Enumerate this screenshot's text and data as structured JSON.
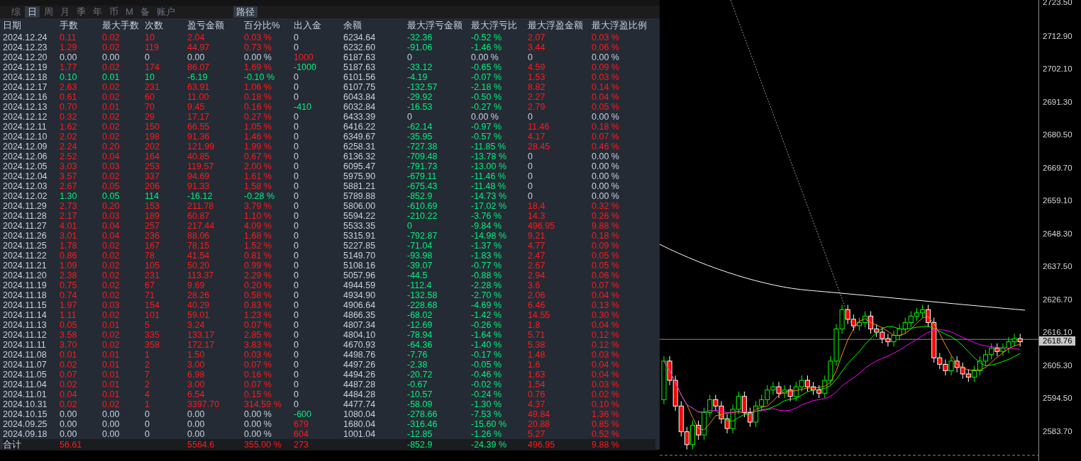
{
  "tabs": [
    {
      "label": "综",
      "selected": false
    },
    {
      "label": "日",
      "selected": true
    },
    {
      "label": "周",
      "selected": false
    },
    {
      "label": "月",
      "selected": false
    },
    {
      "label": "季",
      "selected": false
    },
    {
      "label": "年",
      "selected": false
    },
    {
      "label": "币",
      "selected": false
    },
    {
      "label": "M",
      "selected": false
    },
    {
      "label": "备",
      "selected": false
    },
    {
      "label": "账户",
      "selected": false
    }
  ],
  "path_button": "路径",
  "columns": [
    "日期",
    "手数",
    "最大手数",
    "次数",
    "盈亏金额",
    "百分比%",
    "出入金",
    "余额",
    "最大浮亏金额",
    "最大浮亏比",
    "最大浮盈金额",
    "最大浮盈比例"
  ],
  "rows": [
    {
      "date": "2024.12.24",
      "color": "#ff1a1a",
      "values": [
        "0.11",
        "0.02",
        "10",
        "2.04",
        "0.03 %"
      ],
      "flow": {
        "text": "0",
        "color": "#c8d0dc"
      },
      "balance": "6234.64",
      "loss": {
        "text": "-32.36",
        "pct": "-0.52 %",
        "color": "#00f07a"
      },
      "gain": {
        "text": "2.07",
        "pct": "0.03 %",
        "color": "#ff1a1a"
      }
    },
    {
      "date": "2024.12.23",
      "color": "#ff1a1a",
      "values": [
        "1.29",
        "0.02",
        "119",
        "44.97",
        "0.73 %"
      ],
      "flow": {
        "text": "0",
        "color": "#c8d0dc"
      },
      "balance": "6232.60",
      "loss": {
        "text": "-91.06",
        "pct": "-1.46 %",
        "color": "#00f07a"
      },
      "gain": {
        "text": "3.44",
        "pct": "0.06 %",
        "color": "#ff1a1a"
      }
    },
    {
      "date": "2024.12.20",
      "color": "#c8d0dc",
      "values": [
        "0.00",
        "0.00",
        "0",
        "0.00",
        "0.00 %"
      ],
      "flow": {
        "text": "1000",
        "color": "#ff1a1a"
      },
      "balance": "6187.63",
      "loss": {
        "text": "0",
        "pct": "0.00 %",
        "color": "#c8d0dc"
      },
      "gain": {
        "text": "0",
        "pct": "0.00 %",
        "color": "#c8d0dc"
      }
    },
    {
      "date": "2024.12.19",
      "color": "#ff1a1a",
      "values": [
        "1.77",
        "0.02",
        "174",
        "86.07",
        "1.69 %"
      ],
      "flow": {
        "text": "-1000",
        "color": "#00f07a"
      },
      "balance": "5187.63",
      "loss": {
        "text": "-33.12",
        "pct": "-0.65 %",
        "color": "#00f07a"
      },
      "gain": {
        "text": "4.59",
        "pct": "0.09 %",
        "color": "#ff1a1a"
      }
    },
    {
      "date": "2024.12.18",
      "color": "#00f07a",
      "values": [
        "0.10",
        "0.01",
        "10",
        "-6.19",
        "-0.10 %"
      ],
      "flow": {
        "text": "0",
        "color": "#c8d0dc"
      },
      "balance": "6101.56",
      "loss": {
        "text": "-4.19",
        "pct": "-0.07 %",
        "color": "#00f07a"
      },
      "gain": {
        "text": "1.53",
        "pct": "0.03 %",
        "color": "#ff1a1a"
      }
    },
    {
      "date": "2024.12.17",
      "color": "#ff1a1a",
      "values": [
        "2.63",
        "0.02",
        "231",
        "63.91",
        "1.06 %"
      ],
      "flow": {
        "text": "0",
        "color": "#c8d0dc"
      },
      "balance": "6107.75",
      "loss": {
        "text": "-132.57",
        "pct": "-2.18 %",
        "color": "#00f07a"
      },
      "gain": {
        "text": "8.82",
        "pct": "0.14 %",
        "color": "#ff1a1a"
      }
    },
    {
      "date": "2024.12.16",
      "color": "#ff1a1a",
      "values": [
        "0.61",
        "0.02",
        "60",
        "11.00",
        "0.18 %"
      ],
      "flow": {
        "text": "0",
        "color": "#c8d0dc"
      },
      "balance": "6043.84",
      "loss": {
        "text": "-29.92",
        "pct": "-0.50 %",
        "color": "#00f07a"
      },
      "gain": {
        "text": "2.27",
        "pct": "0.04 %",
        "color": "#ff1a1a"
      }
    },
    {
      "date": "2024.12.13",
      "color": "#ff1a1a",
      "values": [
        "0.70",
        "0.01",
        "70",
        "9.45",
        "0.16 %"
      ],
      "flow": {
        "text": "-410",
        "color": "#00f07a"
      },
      "balance": "6032.84",
      "loss": {
        "text": "-16.53",
        "pct": "-0.27 %",
        "color": "#00f07a"
      },
      "gain": {
        "text": "2.79",
        "pct": "0.05 %",
        "color": "#ff1a1a"
      }
    },
    {
      "date": "2024.12.12",
      "color": "#ff1a1a",
      "values": [
        "0.32",
        "0.02",
        "29",
        "17.17",
        "0.27 %"
      ],
      "flow": {
        "text": "0",
        "color": "#c8d0dc"
      },
      "balance": "6433.39",
      "loss": {
        "text": "0",
        "pct": "0.00 %",
        "color": "#c8d0dc"
      },
      "gain": {
        "text": "0",
        "pct": "0.00 %",
        "color": "#c8d0dc"
      }
    },
    {
      "date": "2024.12.11",
      "color": "#ff1a1a",
      "values": [
        "1.62",
        "0.02",
        "150",
        "66.55",
        "1.05 %"
      ],
      "flow": {
        "text": "0",
        "color": "#c8d0dc"
      },
      "balance": "6416.22",
      "loss": {
        "text": "-62.14",
        "pct": "-0.97 %",
        "color": "#00f07a"
      },
      "gain": {
        "text": "11.46",
        "pct": "0.18 %",
        "color": "#ff1a1a"
      }
    },
    {
      "date": "2024.12.10",
      "color": "#ff1a1a",
      "values": [
        "2.02",
        "0.02",
        "198",
        "91.36",
        "1.46 %"
      ],
      "flow": {
        "text": "0",
        "color": "#c8d0dc"
      },
      "balance": "6349.67",
      "loss": {
        "text": "-35.95",
        "pct": "-0.57 %",
        "color": "#00f07a"
      },
      "gain": {
        "text": "4.17",
        "pct": "0.07 %",
        "color": "#ff1a1a"
      }
    },
    {
      "date": "2024.12.09",
      "color": "#ff1a1a",
      "values": [
        "2.24",
        "0.20",
        "202",
        "121.99",
        "1.99 %"
      ],
      "flow": {
        "text": "0",
        "color": "#c8d0dc"
      },
      "balance": "6258.31",
      "loss": {
        "text": "-727.38",
        "pct": "-11.85 %",
        "color": "#00f07a"
      },
      "gain": {
        "text": "28.45",
        "pct": "0.46 %",
        "color": "#ff1a1a"
      }
    },
    {
      "date": "2024.12.06",
      "color": "#ff1a1a",
      "values": [
        "2.52",
        "0.04",
        "164",
        "40.85",
        "0.67 %"
      ],
      "flow": {
        "text": "0",
        "color": "#c8d0dc"
      },
      "balance": "6136.32",
      "loss": {
        "text": "-709.48",
        "pct": "-13.78 %",
        "color": "#00f07a"
      },
      "gain": {
        "text": "0",
        "pct": "0.00 %",
        "color": "#c8d0dc"
      }
    },
    {
      "date": "2024.12.05",
      "color": "#ff1a1a",
      "values": [
        "3.03",
        "0.03",
        "253",
        "119.57",
        "2.00 %"
      ],
      "flow": {
        "text": "0",
        "color": "#c8d0dc"
      },
      "balance": "6095.47",
      "loss": {
        "text": "-791.73",
        "pct": "-13.00 %",
        "color": "#00f07a"
      },
      "gain": {
        "text": "0",
        "pct": "0.00 %",
        "color": "#c8d0dc"
      }
    },
    {
      "date": "2024.12.04",
      "color": "#ff1a1a",
      "values": [
        "3.57",
        "0.02",
        "337",
        "94.69",
        "1.61 %"
      ],
      "flow": {
        "text": "0",
        "color": "#c8d0dc"
      },
      "balance": "5975.90",
      "loss": {
        "text": "-679.11",
        "pct": "-11.46 %",
        "color": "#00f07a"
      },
      "gain": {
        "text": "0",
        "pct": "0.00 %",
        "color": "#c8d0dc"
      }
    },
    {
      "date": "2024.12.03",
      "color": "#ff1a1a",
      "values": [
        "2.67",
        "0.05",
        "206",
        "91.33",
        "1.58 %"
      ],
      "flow": {
        "text": "0",
        "color": "#c8d0dc"
      },
      "balance": "5881.21",
      "loss": {
        "text": "-675.43",
        "pct": "-11.48 %",
        "color": "#00f07a"
      },
      "gain": {
        "text": "0",
        "pct": "0.00 %",
        "color": "#c8d0dc"
      }
    },
    {
      "date": "2024.12.02",
      "color": "#00f07a",
      "values": [
        "1.30",
        "0.05",
        "114",
        "-16.12",
        "-0.28 %"
      ],
      "flow": {
        "text": "0",
        "color": "#c8d0dc"
      },
      "balance": "5789.88",
      "loss": {
        "text": "-852.9",
        "pct": "-14.73 %",
        "color": "#00f07a"
      },
      "gain": {
        "text": "0",
        "pct": "0.00 %",
        "color": "#c8d0dc"
      }
    },
    {
      "date": "2024.11.29",
      "color": "#ff1a1a",
      "values": [
        "2.73",
        "0.20",
        "153",
        "211.78",
        "3.79 %"
      ],
      "flow": {
        "text": "0",
        "color": "#c8d0dc"
      },
      "balance": "5806.00",
      "loss": {
        "text": "-610.69",
        "pct": "-17.02 %",
        "color": "#00f07a"
      },
      "gain": {
        "text": "18.4",
        "pct": "0.32 %",
        "color": "#ff1a1a"
      }
    },
    {
      "date": "2024.11.28",
      "color": "#ff1a1a",
      "values": [
        "2.17",
        "0.03",
        "189",
        "60.87",
        "1.10 %"
      ],
      "flow": {
        "text": "0",
        "color": "#c8d0dc"
      },
      "balance": "5594.22",
      "loss": {
        "text": "-210.22",
        "pct": "-3.76 %",
        "color": "#00f07a"
      },
      "gain": {
        "text": "14.3",
        "pct": "0.26 %",
        "color": "#ff1a1a"
      }
    },
    {
      "date": "2024.11.27",
      "color": "#ff1a1a",
      "values": [
        "4.01",
        "0.04",
        "257",
        "217.44",
        "4.09 %"
      ],
      "flow": {
        "text": "0",
        "color": "#c8d0dc"
      },
      "balance": "5533.35",
      "loss": {
        "text": "0",
        "pct": "-9.84 %",
        "color": "#00f07a"
      },
      "gain": {
        "text": "496.95",
        "pct": "9.88 %",
        "color": "#ff1a1a"
      }
    },
    {
      "date": "2024.11.26",
      "color": "#ff1a1a",
      "values": [
        "3.01",
        "0.04",
        "236",
        "88.06",
        "1.68 %"
      ],
      "flow": {
        "text": "0",
        "color": "#c8d0dc"
      },
      "balance": "5315.91",
      "loss": {
        "text": "-792.87",
        "pct": "-14.98 %",
        "color": "#00f07a"
      },
      "gain": {
        "text": "9.21",
        "pct": "0.18 %",
        "color": "#ff1a1a"
      }
    },
    {
      "date": "2024.11.25",
      "color": "#ff1a1a",
      "values": [
        "1.78",
        "0.02",
        "167",
        "78.15",
        "1.52 %"
      ],
      "flow": {
        "text": "0",
        "color": "#c8d0dc"
      },
      "balance": "5227.85",
      "loss": {
        "text": "-71.04",
        "pct": "-1.37 %",
        "color": "#00f07a"
      },
      "gain": {
        "text": "4.77",
        "pct": "0.09 %",
        "color": "#ff1a1a"
      }
    },
    {
      "date": "2024.11.22",
      "color": "#ff1a1a",
      "values": [
        "0.86",
        "0.02",
        "78",
        "41.54",
        "0.81 %"
      ],
      "flow": {
        "text": "0",
        "color": "#c8d0dc"
      },
      "balance": "5149.70",
      "loss": {
        "text": "-93.98",
        "pct": "-1.83 %",
        "color": "#00f07a"
      },
      "gain": {
        "text": "2.47",
        "pct": "0.05 %",
        "color": "#ff1a1a"
      }
    },
    {
      "date": "2024.11.21",
      "color": "#ff1a1a",
      "values": [
        "1.09",
        "0.02",
        "105",
        "50.20",
        "0.99 %"
      ],
      "flow": {
        "text": "0",
        "color": "#c8d0dc"
      },
      "balance": "5108.16",
      "loss": {
        "text": "-39.07",
        "pct": "-0.77 %",
        "color": "#00f07a"
      },
      "gain": {
        "text": "2.67",
        "pct": "0.05 %",
        "color": "#ff1a1a"
      }
    },
    {
      "date": "2024.11.20",
      "color": "#ff1a1a",
      "values": [
        "2.38",
        "0.02",
        "231",
        "113.37",
        "2.29 %"
      ],
      "flow": {
        "text": "0",
        "color": "#c8d0dc"
      },
      "balance": "5057.96",
      "loss": {
        "text": "-44.5",
        "pct": "-0.88 %",
        "color": "#00f07a"
      },
      "gain": {
        "text": "2.94",
        "pct": "0.06 %",
        "color": "#ff1a1a"
      }
    },
    {
      "date": "2024.11.19",
      "color": "#ff1a1a",
      "values": [
        "0.75",
        "0.02",
        "67",
        "9.69",
        "0.20 %"
      ],
      "flow": {
        "text": "0",
        "color": "#c8d0dc"
      },
      "balance": "4944.59",
      "loss": {
        "text": "-112.4",
        "pct": "-2.28 %",
        "color": "#00f07a"
      },
      "gain": {
        "text": "3.6",
        "pct": "0.07 %",
        "color": "#ff1a1a"
      }
    },
    {
      "date": "2024.11.18",
      "color": "#ff1a1a",
      "values": [
        "0.74",
        "0.02",
        "71",
        "28.26",
        "0.58 %"
      ],
      "flow": {
        "text": "0",
        "color": "#c8d0dc"
      },
      "balance": "4934.90",
      "loss": {
        "text": "-132.58",
        "pct": "-2.70 %",
        "color": "#00f07a"
      },
      "gain": {
        "text": "2.06",
        "pct": "0.04 %",
        "color": "#ff1a1a"
      }
    },
    {
      "date": "2024.11.15",
      "color": "#ff1a1a",
      "values": [
        "1.97",
        "0.03",
        "154",
        "40.29",
        "0.83 %"
      ],
      "flow": {
        "text": "0",
        "color": "#c8d0dc"
      },
      "balance": "4906.64",
      "loss": {
        "text": "-228.68",
        "pct": "-4.69 %",
        "color": "#00f07a"
      },
      "gain": {
        "text": "6.46",
        "pct": "0.13 %",
        "color": "#ff1a1a"
      }
    },
    {
      "date": "2024.11.14",
      "color": "#ff1a1a",
      "values": [
        "1.11",
        "0.02",
        "101",
        "59.01",
        "1.23 %"
      ],
      "flow": {
        "text": "0",
        "color": "#c8d0dc"
      },
      "balance": "4866.35",
      "loss": {
        "text": "-68.02",
        "pct": "-1.42 %",
        "color": "#00f07a"
      },
      "gain": {
        "text": "14.55",
        "pct": "0.30 %",
        "color": "#ff1a1a"
      }
    },
    {
      "date": "2024.11.13",
      "color": "#ff1a1a",
      "values": [
        "0.05",
        "0.01",
        "5",
        "3.24",
        "0.07 %"
      ],
      "flow": {
        "text": "0",
        "color": "#c8d0dc"
      },
      "balance": "4807.34",
      "loss": {
        "text": "-12.69",
        "pct": "-0.26 %",
        "color": "#00f07a"
      },
      "gain": {
        "text": "1.8",
        "pct": "0.04 %",
        "color": "#ff1a1a"
      }
    },
    {
      "date": "2024.11.12",
      "color": "#ff1a1a",
      "values": [
        "3.58",
        "0.02",
        "335",
        "133.17",
        "2.85 %"
      ],
      "flow": {
        "text": "0",
        "color": "#c8d0dc"
      },
      "balance": "4804.10",
      "loss": {
        "text": "-78.94",
        "pct": "-1.64 %",
        "color": "#00f07a"
      },
      "gain": {
        "text": "5.71",
        "pct": "0.12 %",
        "color": "#ff1a1a"
      }
    },
    {
      "date": "2024.11.11",
      "color": "#ff1a1a",
      "values": [
        "3.70",
        "0.02",
        "358",
        "172.17",
        "3.83 %"
      ],
      "flow": {
        "text": "0",
        "color": "#c8d0dc"
      },
      "balance": "4670.93",
      "loss": {
        "text": "-64.36",
        "pct": "-1.40 %",
        "color": "#00f07a"
      },
      "gain": {
        "text": "5.38",
        "pct": "0.12 %",
        "color": "#ff1a1a"
      }
    },
    {
      "date": "2024.11.08",
      "color": "#ff1a1a",
      "values": [
        "0.01",
        "0.01",
        "1",
        "1.50",
        "0.03 %"
      ],
      "flow": {
        "text": "0",
        "color": "#c8d0dc"
      },
      "balance": "4498.76",
      "loss": {
        "text": "-7.76",
        "pct": "-0.17 %",
        "color": "#00f07a"
      },
      "gain": {
        "text": "1.48",
        "pct": "0.03 %",
        "color": "#ff1a1a"
      }
    },
    {
      "date": "2024.11.07",
      "color": "#ff1a1a",
      "values": [
        "0.02",
        "0.01",
        "2",
        "3.00",
        "0.07 %"
      ],
      "flow": {
        "text": "0",
        "color": "#c8d0dc"
      },
      "balance": "4497.26",
      "loss": {
        "text": "-2.38",
        "pct": "-0.05 %",
        "color": "#00f07a"
      },
      "gain": {
        "text": "1.6",
        "pct": "0.04 %",
        "color": "#ff1a1a"
      }
    },
    {
      "date": "2024.11.05",
      "color": "#ff1a1a",
      "values": [
        "0.07",
        "0.01",
        "7",
        "6.98",
        "0.16 %"
      ],
      "flow": {
        "text": "0",
        "color": "#c8d0dc"
      },
      "balance": "4494.26",
      "loss": {
        "text": "-20.72",
        "pct": "-0.46 %",
        "color": "#00f07a"
      },
      "gain": {
        "text": "1.63",
        "pct": "0.04 %",
        "color": "#ff1a1a"
      }
    },
    {
      "date": "2024.11.04",
      "color": "#ff1a1a",
      "values": [
        "0.02",
        "0.01",
        "2",
        "3.00",
        "0.07 %"
      ],
      "flow": {
        "text": "0",
        "color": "#c8d0dc"
      },
      "balance": "4487.28",
      "loss": {
        "text": "-0.67",
        "pct": "-0.02 %",
        "color": "#00f07a"
      },
      "gain": {
        "text": "1.54",
        "pct": "0.03 %",
        "color": "#ff1a1a"
      }
    },
    {
      "date": "2024.11.01",
      "color": "#ff1a1a",
      "values": [
        "0.04",
        "0.01",
        "4",
        "6.54",
        "0.15 %"
      ],
      "flow": {
        "text": "0",
        "color": "#c8d0dc"
      },
      "balance": "4484.28",
      "loss": {
        "text": "-10.57",
        "pct": "-0.24 %",
        "color": "#00f07a"
      },
      "gain": {
        "text": "0.76",
        "pct": "0.02 %",
        "color": "#ff1a1a"
      }
    },
    {
      "date": "2024.10.31",
      "color": "#ff1a1a",
      "values": [
        "0.02",
        "0.02",
        "1",
        "3397.70",
        "314.59 %"
      ],
      "flow": {
        "text": "0",
        "color": "#c8d0dc"
      },
      "balance": "4477.74",
      "loss": {
        "text": "-58.09",
        "pct": "-1.30 %",
        "color": "#00f07a"
      },
      "gain": {
        "text": "4.37",
        "pct": "0.10 %",
        "color": "#ff1a1a"
      }
    },
    {
      "date": "2024.10.15",
      "color": "#c8d0dc",
      "values": [
        "0.00",
        "0.00",
        "0",
        "0.00",
        "0.00 %"
      ],
      "flow": {
        "text": "-600",
        "color": "#00f07a"
      },
      "balance": "1080.04",
      "loss": {
        "text": "-278.66",
        "pct": "-7.53 %",
        "color": "#00f07a"
      },
      "gain": {
        "text": "49.84",
        "pct": "1.36 %",
        "color": "#ff1a1a"
      }
    },
    {
      "date": "2024.09.25",
      "color": "#c8d0dc",
      "values": [
        "0.00",
        "0.00",
        "0",
        "0.00",
        "0.00 %"
      ],
      "flow": {
        "text": "679",
        "color": "#ff1a1a"
      },
      "balance": "1680.04",
      "loss": {
        "text": "-316.46",
        "pct": "-15.60 %",
        "color": "#00f07a"
      },
      "gain": {
        "text": "20.88",
        "pct": "0.85 %",
        "color": "#ff1a1a"
      }
    },
    {
      "date": "2024.09.18",
      "color": "#c8d0dc",
      "values": [
        "0.00",
        "0.00",
        "0",
        "0.00",
        "0.00 %"
      ],
      "flow": {
        "text": "604",
        "color": "#ff1a1a"
      },
      "balance": "1001.04",
      "loss": {
        "text": "-12.85",
        "pct": "-1.26 %",
        "color": "#00f07a"
      },
      "gain": {
        "text": "5.27",
        "pct": "0.52 %",
        "color": "#ff1a1a"
      }
    }
  ],
  "totals": {
    "label": "合计",
    "color": "#ff1a1a",
    "lots": "56.61",
    "pnl": "5564.6",
    "pct": "355.00 %",
    "flow": "273",
    "loss": {
      "text": "-852.9",
      "pct": "-24.39 %",
      "color": "#00f07a"
    },
    "gain": {
      "text": "496.95",
      "pct": "9.88 %",
      "color": "#ff1a1a"
    }
  },
  "price_axis": {
    "labels": [
      "2723.50",
      "2712.90",
      "2702.10",
      "2691.30",
      "2680.50",
      "2669.70",
      "2659.10",
      "2648.30",
      "2637.50",
      "2626.70",
      "2616.10",
      "2605.30",
      "2594.50",
      "2583.70"
    ],
    "current": "2618.76"
  }
}
